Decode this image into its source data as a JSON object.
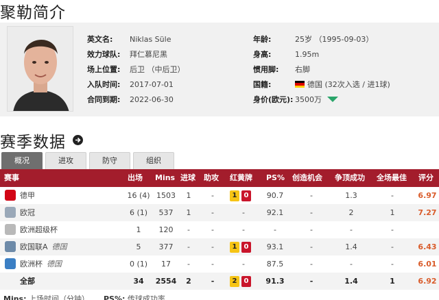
{
  "page_title": "聚勒简介",
  "profile": {
    "left": [
      {
        "label": "英文名:",
        "value": "Niklas Süle"
      },
      {
        "label": "效力球队:",
        "value": "拜仁慕尼黑"
      },
      {
        "label": "场上位置:",
        "value": "后卫 （中后卫）"
      },
      {
        "label": "入队时间:",
        "value": "2017-07-01"
      },
      {
        "label": "合同到期:",
        "value": "2022-06-30"
      }
    ],
    "right": [
      {
        "label": "年龄:",
        "value": "25岁 （1995-09-03）"
      },
      {
        "label": "身高:",
        "value": "1.95m"
      },
      {
        "label": "惯用脚:",
        "value": "右脚"
      },
      {
        "label": "国籍:",
        "value": "德国 (32次入选 / 进1球)"
      },
      {
        "label": "身价(欧元):",
        "value": "3500万"
      }
    ],
    "flag_colors": [
      "#000000",
      "#dd0000",
      "#ffce00"
    ],
    "trend_icon": "trend-up-icon",
    "trend_color": "#2aa56a"
  },
  "section_title": "赛季数据",
  "tabs": [
    "概况",
    "进攻",
    "防守",
    "组织"
  ],
  "active_tab": 0,
  "table": {
    "headers": [
      "赛事",
      "出场",
      "Mins",
      "进球",
      "助攻",
      "红黄牌",
      "PS%",
      "创造机会",
      "争顶成功",
      "全场最佳",
      "评分"
    ],
    "rows": [
      {
        "name": "德甲",
        "sub": "",
        "icon": "bundesliga-icon",
        "icon_color": "#d20515",
        "apps": "16 (4)",
        "mins": "1503",
        "goals": "1",
        "assists": "-",
        "yellow": "1",
        "red": "0",
        "ps": "90.7",
        "chances": "-",
        "aerial": "1.3",
        "motm": "-",
        "rating": "6.97"
      },
      {
        "name": "欧冠",
        "sub": "",
        "icon": "champions-league-icon",
        "icon_color": "#9aa8b8",
        "apps": "6 (1)",
        "mins": "537",
        "goals": "1",
        "assists": "-",
        "yellow": "",
        "red": "",
        "ps": "92.1",
        "chances": "-",
        "aerial": "2",
        "motm": "1",
        "rating": "7.27"
      },
      {
        "name": "欧洲超级杯",
        "sub": "",
        "icon": "super-cup-icon",
        "icon_color": "#b9b9b9",
        "apps": "1",
        "mins": "120",
        "goals": "-",
        "assists": "-",
        "yellow": "",
        "red": "",
        "ps": "-",
        "chances": "-",
        "aerial": "-",
        "motm": "-",
        "rating": ""
      },
      {
        "name": "欧国联A",
        "sub": "德国",
        "icon": "nations-league-icon",
        "icon_color": "#6d8aa8",
        "apps": "5",
        "mins": "377",
        "goals": "-",
        "assists": "-",
        "yellow": "1",
        "red": "0",
        "ps": "93.1",
        "chances": "-",
        "aerial": "1.4",
        "motm": "-",
        "rating": "6.43"
      },
      {
        "name": "欧洲杯",
        "sub": "德国",
        "icon": "euro-cup-icon",
        "icon_color": "#3b7fc4",
        "apps": "0 (1)",
        "mins": "17",
        "goals": "-",
        "assists": "-",
        "yellow": "",
        "red": "",
        "ps": "87.5",
        "chances": "-",
        "aerial": "-",
        "motm": "-",
        "rating": "6.01"
      }
    ],
    "total": {
      "name": "全部",
      "apps": "34",
      "mins": "2554",
      "goals": "2",
      "assists": "-",
      "yellow": "2",
      "red": "0",
      "ps": "91.3",
      "chances": "-",
      "aerial": "1.4",
      "motm": "1",
      "rating": "6.92"
    }
  },
  "footnote": {
    "mins_label": "Mins:",
    "mins_text": "上场时间（分钟）",
    "ps_label": "PS%:",
    "ps_text": "传球成功率"
  },
  "colors": {
    "header_bg": "#a31d2c",
    "rating": "#d95b2a",
    "yellow_card": "#f6c415",
    "red_card": "#c9152b"
  }
}
